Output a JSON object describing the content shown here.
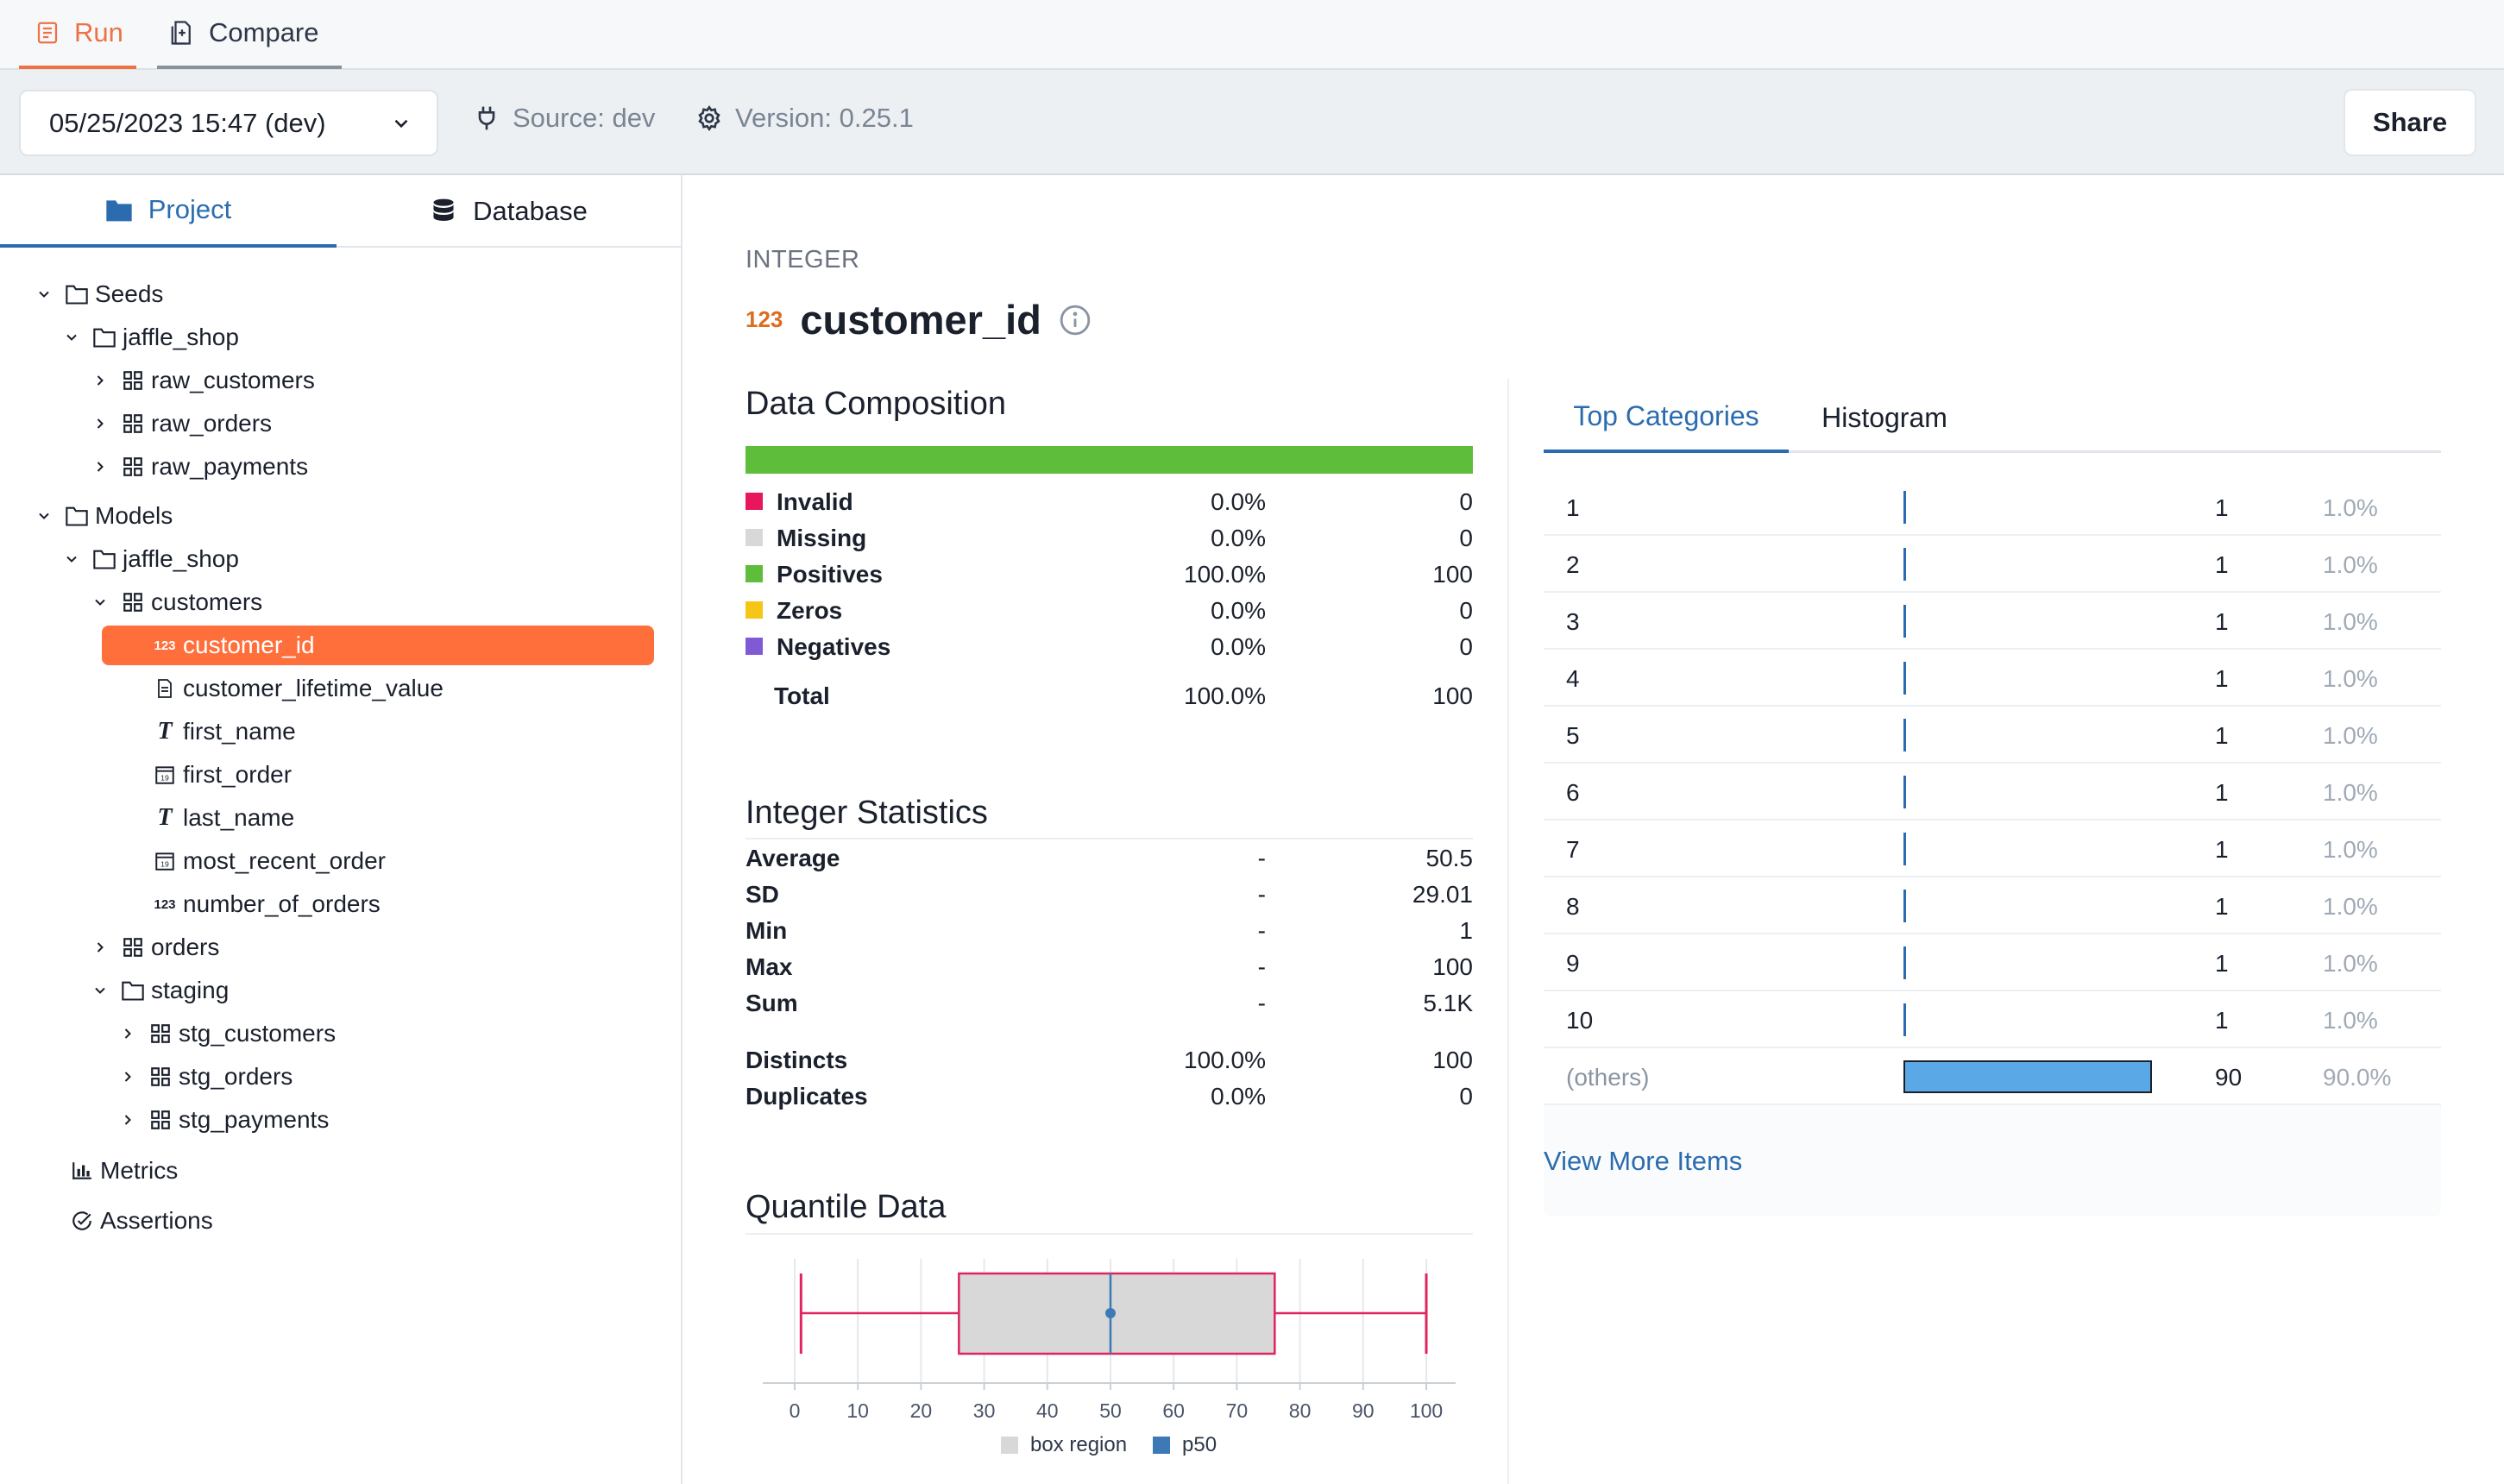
{
  "top_tabs": {
    "run": "Run",
    "compare": "Compare"
  },
  "toolbar": {
    "run_select": "05/25/2023 15:47 (dev)",
    "source": "Source: dev",
    "version": "Version: 0.25.1",
    "share": "Share"
  },
  "sidebar": {
    "tabs": {
      "project": "Project",
      "database": "Database"
    },
    "tree": {
      "seeds": "Seeds",
      "seeds_jaffle": "jaffle_shop",
      "raw_customers": "raw_customers",
      "raw_orders": "raw_orders",
      "raw_payments": "raw_payments",
      "models": "Models",
      "models_jaffle": "jaffle_shop",
      "customers": "customers",
      "customer_id": "customer_id",
      "customer_lifetime_value": "customer_lifetime_value",
      "first_name": "first_name",
      "first_order": "first_order",
      "last_name": "last_name",
      "most_recent_order": "most_recent_order",
      "number_of_orders": "number_of_orders",
      "orders": "orders",
      "staging": "staging",
      "stg_customers": "stg_customers",
      "stg_orders": "stg_orders",
      "stg_payments": "stg_payments",
      "metrics": "Metrics",
      "assertions": "Assertions"
    },
    "type_tags": {
      "int": "123",
      "date": "19",
      "text": "T"
    }
  },
  "column": {
    "type": "INTEGER",
    "type_badge": "123",
    "name": "customer_id"
  },
  "composition": {
    "title": "Data Composition",
    "rows": [
      {
        "label": "Invalid",
        "pct": "0.0%",
        "count": "0",
        "color": "#e8175d"
      },
      {
        "label": "Missing",
        "pct": "0.0%",
        "count": "0",
        "color": "#d8d8d8"
      },
      {
        "label": "Positives",
        "pct": "100.0%",
        "count": "100",
        "color": "#5ebd3a"
      },
      {
        "label": "Zeros",
        "pct": "0.0%",
        "count": "0",
        "color": "#f5c518"
      },
      {
        "label": "Negatives",
        "pct": "0.0%",
        "count": "0",
        "color": "#805ad5"
      }
    ],
    "total": {
      "label": "Total",
      "pct": "100.0%",
      "count": "100"
    }
  },
  "stats": {
    "title": "Integer Statistics",
    "rows": [
      {
        "label": "Average",
        "mid": "-",
        "val": "50.5"
      },
      {
        "label": "SD",
        "mid": "-",
        "val": "29.01"
      },
      {
        "label": "Min",
        "mid": "-",
        "val": "1"
      },
      {
        "label": "Max",
        "mid": "-",
        "val": "100"
      },
      {
        "label": "Sum",
        "mid": "-",
        "val": "5.1K"
      }
    ],
    "extra": [
      {
        "label": "Distincts",
        "mid": "100.0%",
        "val": "100"
      },
      {
        "label": "Duplicates",
        "mid": "0.0%",
        "val": "0"
      }
    ]
  },
  "quantile": {
    "title": "Quantile Data",
    "legend_box": "box region",
    "legend_p50": "p50"
  },
  "chart_data": {
    "type": "box",
    "min": 1,
    "q1": 26,
    "median": 50,
    "q3": 76,
    "max": 100,
    "xlim": [
      -5,
      105
    ],
    "x_ticks": [
      "0",
      "10",
      "20",
      "30",
      "40",
      "50",
      "60",
      "70",
      "80",
      "90",
      "100"
    ],
    "grid": true,
    "legend": [
      "box region",
      "p50"
    ],
    "colors": {
      "box_fill": "#d8d8d8",
      "box_stroke": "#e0245e",
      "p50": "#3d7ab5"
    }
  },
  "categories": {
    "tabs": {
      "top": "Top Categories",
      "histogram": "Histogram"
    },
    "rows": [
      {
        "key": "1",
        "count": "1",
        "pct": "1.0%",
        "fraction": 0.01
      },
      {
        "key": "2",
        "count": "1",
        "pct": "1.0%",
        "fraction": 0.01
      },
      {
        "key": "3",
        "count": "1",
        "pct": "1.0%",
        "fraction": 0.01
      },
      {
        "key": "4",
        "count": "1",
        "pct": "1.0%",
        "fraction": 0.01
      },
      {
        "key": "5",
        "count": "1",
        "pct": "1.0%",
        "fraction": 0.01
      },
      {
        "key": "6",
        "count": "1",
        "pct": "1.0%",
        "fraction": 0.01
      },
      {
        "key": "7",
        "count": "1",
        "pct": "1.0%",
        "fraction": 0.01
      },
      {
        "key": "8",
        "count": "1",
        "pct": "1.0%",
        "fraction": 0.01
      },
      {
        "key": "9",
        "count": "1",
        "pct": "1.0%",
        "fraction": 0.01
      },
      {
        "key": "10",
        "count": "1",
        "pct": "1.0%",
        "fraction": 0.01
      },
      {
        "key": "(others)",
        "count": "90",
        "pct": "90.0%",
        "fraction": 0.9
      }
    ],
    "view_more": "View More Items"
  }
}
